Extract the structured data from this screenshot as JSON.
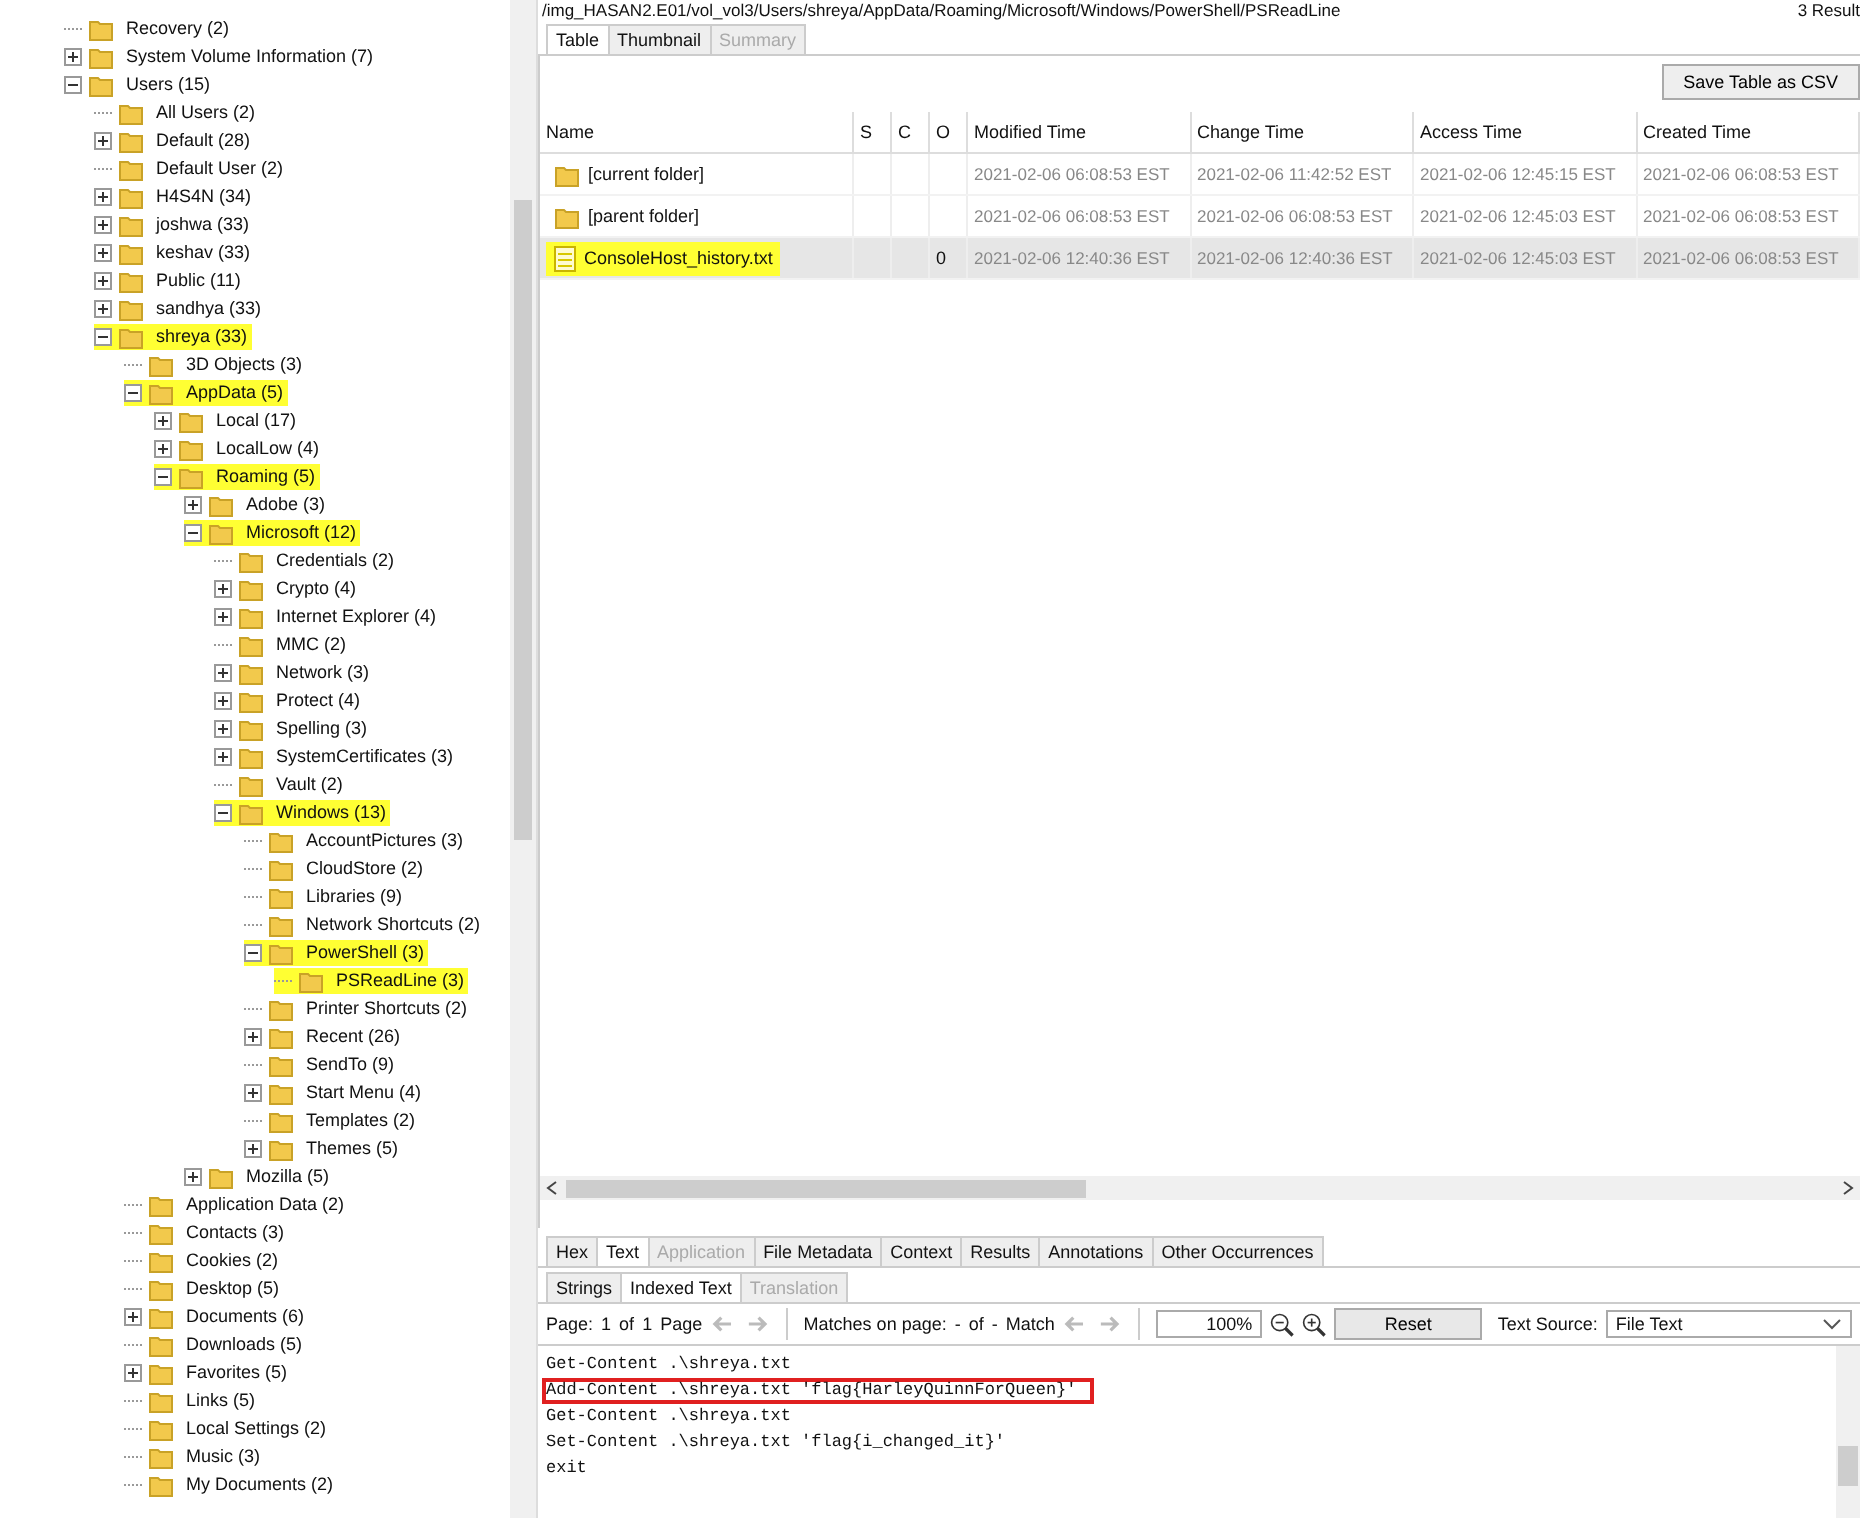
{
  "tree": [
    {
      "label": "Recovery (2)",
      "highlighted": false
    },
    {
      "label": "System Volume Information (7)",
      "expanded": false,
      "highlighted": false
    },
    {
      "label": "Users (15)",
      "expanded": true,
      "highlighted": false,
      "children": [
        {
          "label": "All Users (2)",
          "highlighted": false
        },
        {
          "label": "Default (28)",
          "expanded": false,
          "highlighted": false
        },
        {
          "label": "Default User (2)",
          "highlighted": false
        },
        {
          "label": "H4S4N (34)",
          "expanded": false,
          "highlighted": false
        },
        {
          "label": "joshwa (33)",
          "expanded": false,
          "highlighted": false
        },
        {
          "label": "keshav (33)",
          "expanded": false,
          "highlighted": false
        },
        {
          "label": "Public (11)",
          "expanded": false,
          "highlighted": false
        },
        {
          "label": "sandhya (33)",
          "expanded": false,
          "highlighted": false
        },
        {
          "label": "shreya (33)",
          "expanded": true,
          "highlighted": true,
          "children": [
            {
              "label": "3D Objects (3)",
              "highlighted": false
            },
            {
              "label": "AppData (5)",
              "expanded": true,
              "highlighted": true,
              "children": [
                {
                  "label": "Local (17)",
                  "expanded": false,
                  "highlighted": false
                },
                {
                  "label": "LocalLow (4)",
                  "expanded": false,
                  "highlighted": false
                },
                {
                  "label": "Roaming (5)",
                  "expanded": true,
                  "highlighted": true,
                  "children": [
                    {
                      "label": "Adobe (3)",
                      "expanded": false,
                      "highlighted": false
                    },
                    {
                      "label": "Microsoft (12)",
                      "expanded": true,
                      "highlighted": true,
                      "children": [
                        {
                          "label": "Credentials (2)",
                          "highlighted": false
                        },
                        {
                          "label": "Crypto (4)",
                          "expanded": false,
                          "highlighted": false
                        },
                        {
                          "label": "Internet Explorer (4)",
                          "expanded": false,
                          "highlighted": false
                        },
                        {
                          "label": "MMC (2)",
                          "highlighted": false
                        },
                        {
                          "label": "Network (3)",
                          "expanded": false,
                          "highlighted": false
                        },
                        {
                          "label": "Protect (4)",
                          "expanded": false,
                          "highlighted": false
                        },
                        {
                          "label": "Spelling (3)",
                          "expanded": false,
                          "highlighted": false
                        },
                        {
                          "label": "SystemCertificates (3)",
                          "expanded": false,
                          "highlighted": false
                        },
                        {
                          "label": "Vault (2)",
                          "highlighted": false
                        },
                        {
                          "label": "Windows (13)",
                          "expanded": true,
                          "highlighted": true,
                          "children": [
                            {
                              "label": "AccountPictures (3)",
                              "highlighted": false
                            },
                            {
                              "label": "CloudStore (2)",
                              "highlighted": false
                            },
                            {
                              "label": "Libraries (9)",
                              "highlighted": false
                            },
                            {
                              "label": "Network Shortcuts (2)",
                              "highlighted": false
                            },
                            {
                              "label": "PowerShell (3)",
                              "expanded": true,
                              "highlighted": true,
                              "children": [
                                {
                                  "label": "PSReadLine (3)",
                                  "highlighted": true
                                }
                              ]
                            },
                            {
                              "label": "Printer Shortcuts (2)",
                              "highlighted": false
                            },
                            {
                              "label": "Recent (26)",
                              "expanded": false,
                              "highlighted": false
                            },
                            {
                              "label": "SendTo (9)",
                              "highlighted": false
                            },
                            {
                              "label": "Start Menu (4)",
                              "expanded": false,
                              "highlighted": false
                            },
                            {
                              "label": "Templates (2)",
                              "highlighted": false
                            },
                            {
                              "label": "Themes (5)",
                              "expanded": false,
                              "highlighted": false
                            }
                          ]
                        }
                      ]
                    },
                    {
                      "label": "Mozilla (5)",
                      "expanded": false,
                      "highlighted": false
                    }
                  ]
                }
              ]
            },
            {
              "label": "Application Data (2)",
              "highlighted": false
            },
            {
              "label": "Contacts (3)",
              "highlighted": false
            },
            {
              "label": "Cookies (2)",
              "highlighted": false
            },
            {
              "label": "Desktop (5)",
              "highlighted": false
            },
            {
              "label": "Documents (6)",
              "expanded": false,
              "highlighted": false
            },
            {
              "label": "Downloads (5)",
              "highlighted": false
            },
            {
              "label": "Favorites (5)",
              "expanded": false,
              "highlighted": false
            },
            {
              "label": "Links (5)",
              "highlighted": false
            },
            {
              "label": "Local Settings (2)",
              "highlighted": false
            },
            {
              "label": "Music (3)",
              "highlighted": false
            },
            {
              "label": "My Documents (2)",
              "highlighted": false
            }
          ]
        }
      ]
    }
  ],
  "path": "/img_HASAN2.E01/vol_vol3/Users/shreya/AppData/Roaming/Microsoft/Windows/PowerShell/PSReadLine",
  "result_count": "3 Result",
  "view_tabs": [
    {
      "label": "Table",
      "selected": true,
      "disabled": false
    },
    {
      "label": "Thumbnail",
      "selected": false,
      "disabled": false
    },
    {
      "label": "Summary",
      "selected": false,
      "disabled": true
    }
  ],
  "save_button": "Save Table as CSV",
  "table": {
    "columns": [
      "Name",
      "S",
      "C",
      "O",
      "Modified Time",
      "Change Time",
      "Access Time",
      "Created Time"
    ],
    "rows": [
      {
        "kind": "folder",
        "name": "[current folder]",
        "modified": "2021-02-06 06:08:53 EST",
        "change": "2021-02-06 11:42:52 EST",
        "access": "2021-02-06 12:45:15 EST",
        "created": "2021-02-06 06:08:53 EST",
        "selected": false,
        "highlighted": false
      },
      {
        "kind": "folder",
        "name": "[parent folder]",
        "modified": "2021-02-06 06:08:53 EST",
        "change": "2021-02-06 06:08:53 EST",
        "access": "2021-02-06 12:45:03 EST",
        "created": "2021-02-06 06:08:53 EST",
        "selected": false,
        "highlighted": false
      },
      {
        "kind": "file",
        "name": "ConsoleHost_history.txt",
        "o": "0",
        "modified": "2021-02-06 12:40:36 EST",
        "change": "2021-02-06 12:40:36 EST",
        "access": "2021-02-06 12:45:03 EST",
        "created": "2021-02-06 06:08:53 EST",
        "selected": true,
        "highlighted": true
      }
    ]
  },
  "content_tabs": [
    {
      "label": "Hex",
      "selected": false,
      "disabled": false
    },
    {
      "label": "Text",
      "selected": true,
      "disabled": false
    },
    {
      "label": "Application",
      "selected": false,
      "disabled": true
    },
    {
      "label": "File Metadata",
      "selected": false,
      "disabled": false
    },
    {
      "label": "Context",
      "selected": false,
      "disabled": false
    },
    {
      "label": "Results",
      "selected": false,
      "disabled": false
    },
    {
      "label": "Annotations",
      "selected": false,
      "disabled": false
    },
    {
      "label": "Other Occurrences",
      "selected": false,
      "disabled": false
    }
  ],
  "text_tabs": [
    {
      "label": "Strings",
      "selected": false,
      "disabled": false
    },
    {
      "label": "Indexed Text",
      "selected": true,
      "disabled": false
    },
    {
      "label": "Translation",
      "selected": false,
      "disabled": true
    }
  ],
  "toolbar": {
    "page_label": "Page:",
    "page": "1",
    "of": "of",
    "pages": "1",
    "page_unit": "Page",
    "matches_label": "Matches on page:",
    "match": "-",
    "match_of": "of",
    "match_total": "-",
    "match_unit": "Match",
    "zoom": "100%",
    "reset": "Reset",
    "source_label": "Text Source:",
    "source": "File Text"
  },
  "text_lines": [
    {
      "text": "Get-Content .\\shreya.txt",
      "boxed": false
    },
    {
      "text": "Add-Content .\\shreya.txt 'flag{HarleyQuinnForQueen}'",
      "boxed": true
    },
    {
      "text": "Get-Content .\\shreya.txt",
      "boxed": false
    },
    {
      "text": "Set-Content .\\shreya.txt 'flag{i_changed_it}'",
      "boxed": false
    },
    {
      "text": "exit",
      "boxed": false
    }
  ]
}
